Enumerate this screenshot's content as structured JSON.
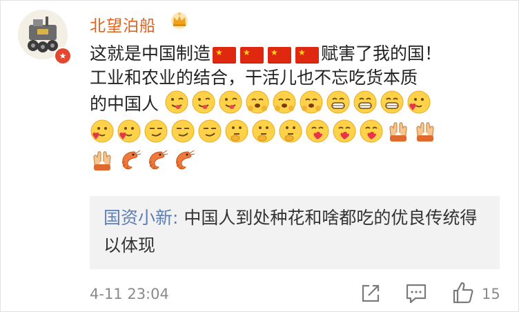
{
  "comment": {
    "username": "北望泊船",
    "text_line1_before": "这就是中国制造",
    "flag_count": 4,
    "text_line1_after": "赋害了我的国！",
    "text_line2": "工业和农业的结合，干活儿也不忘吃货本质",
    "text_line3": "的中国人",
    "emoji_row3": [
      "tongue-face",
      "tongue-face",
      "tongue-face",
      "hug-face",
      "hug-face",
      "hug-face",
      "grin-face",
      "grin-face",
      "grin-face",
      "heart-face"
    ],
    "emoji_row4": [
      "heart-face",
      "heart-face",
      "smirk-face",
      "smirk-face",
      "smirk-face",
      "thinking-face",
      "thinking-face",
      "thinking-face",
      "love-face",
      "love-face",
      "love-face",
      "clap-hands",
      "clap-hands"
    ],
    "emoji_row5": [
      "clap-hands",
      "shrimp",
      "shrimp",
      "shrimp"
    ],
    "timestamp": "4-11 23:04",
    "like_count": "15"
  },
  "reply": {
    "username": "国资小新",
    "separator": ": ",
    "text": "中国人到处种花和啥都吃的优良传统得以体现"
  },
  "colors": {
    "username": "#e0611b",
    "reply_user": "#5b7eb6",
    "flag_red": "#de2910",
    "meta_gray": "#8a8a8a"
  },
  "icons": {
    "share": "share-icon",
    "comment": "comment-icon",
    "like": "thumbs-up-icon",
    "badge": "verified-badge-icon",
    "crown": "crown-icon"
  }
}
